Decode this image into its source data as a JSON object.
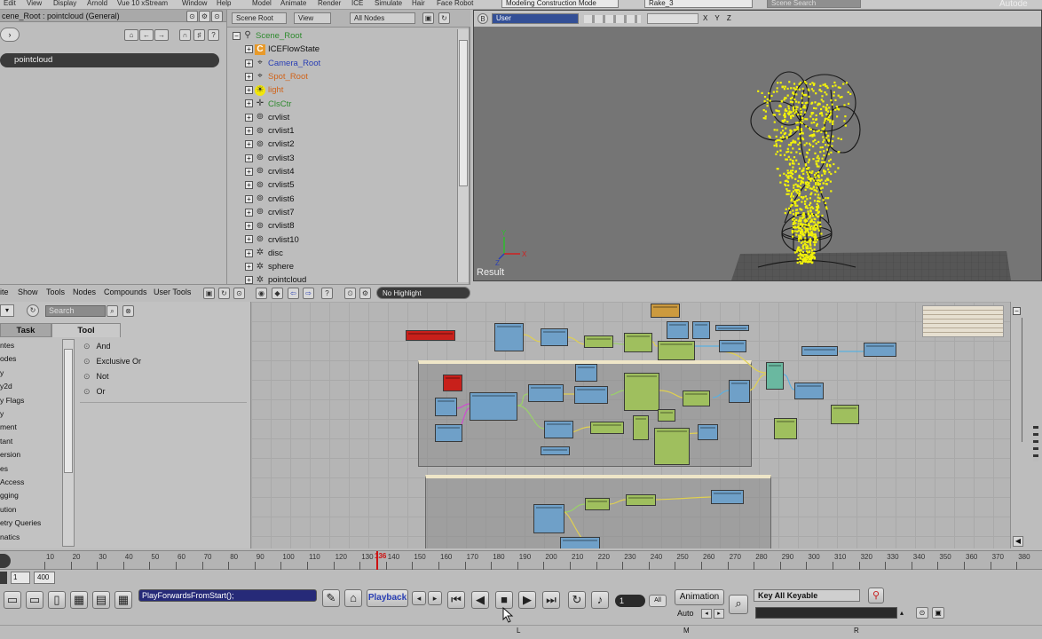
{
  "menubar": {
    "items": [
      "Edit",
      "View",
      "Display",
      "Arnold",
      "Vue 10 xStream",
      "Window",
      "Help",
      "Model",
      "Animate",
      "Render",
      "ICE",
      "Simulate",
      "Hair",
      "Face Robot"
    ],
    "mode": "Modeling Construction Mode",
    "scene_field": "Rake_3",
    "scene_search": "Scene Search",
    "brand": "Autode"
  },
  "explorer": {
    "title": "cene_Root : pointcloud (General)",
    "selected": "pointcloud"
  },
  "scene_tree": {
    "head_root": "Scene Root",
    "head_view": "View",
    "head_filter": "All Nodes",
    "items": [
      {
        "label": "Scene_Root",
        "color": "#2f8a2f",
        "icon": "root-icon",
        "indent": 0
      },
      {
        "label": "ICEFlowState",
        "color": "#111111",
        "icon": "ice-icon",
        "indent": 1
      },
      {
        "label": "Camera_Root",
        "color": "#2a3fb4",
        "icon": "camera-icon",
        "indent": 1
      },
      {
        "label": "Spot_Root",
        "color": "#d0641b",
        "icon": "spotlight-icon",
        "indent": 1
      },
      {
        "label": "light",
        "color": "#d0641b",
        "icon": "light-icon",
        "indent": 1
      },
      {
        "label": "ClsCtr",
        "color": "#2f8a2f",
        "icon": "null-icon",
        "indent": 1
      },
      {
        "label": "crvlist",
        "color": "#111111",
        "icon": "curve-icon",
        "indent": 1
      },
      {
        "label": "crvlist1",
        "color": "#111111",
        "icon": "curve-icon",
        "indent": 1
      },
      {
        "label": "crvlist2",
        "color": "#111111",
        "icon": "curve-icon",
        "indent": 1
      },
      {
        "label": "crvlist3",
        "color": "#111111",
        "icon": "curve-icon",
        "indent": 1
      },
      {
        "label": "crvlist4",
        "color": "#111111",
        "icon": "curve-icon",
        "indent": 1
      },
      {
        "label": "crvlist5",
        "color": "#111111",
        "icon": "curve-icon",
        "indent": 1
      },
      {
        "label": "crvlist6",
        "color": "#111111",
        "icon": "curve-icon",
        "indent": 1
      },
      {
        "label": "crvlist7",
        "color": "#111111",
        "icon": "curve-icon",
        "indent": 1
      },
      {
        "label": "crvlist8",
        "color": "#111111",
        "icon": "curve-icon",
        "indent": 1
      },
      {
        "label": "crvlist10",
        "color": "#111111",
        "icon": "curve-icon",
        "indent": 1
      },
      {
        "label": "disc",
        "color": "#111111",
        "icon": "mesh-icon",
        "indent": 1
      },
      {
        "label": "sphere",
        "color": "#111111",
        "icon": "mesh-icon",
        "indent": 1
      },
      {
        "label": "pointcloud",
        "color": "#111111",
        "icon": "pointcloud-icon",
        "indent": 1
      }
    ]
  },
  "viewport": {
    "camera": "User",
    "axes": "X Y Z",
    "label": "Result"
  },
  "ice_toolbar": {
    "menus": [
      "ite",
      "Show",
      "Tools",
      "Nodes",
      "Compounds",
      "User Tools"
    ],
    "highlight": "No Highlight"
  },
  "ice_left": {
    "search_placeholder": "Search",
    "tab_task": "Task",
    "tab_tool": "Tool",
    "categories": [
      "ntes",
      "odes",
      "y",
      "y2d",
      "y Flags",
      "y",
      "ment",
      "tant",
      "ersion",
      "es",
      "Access",
      "gging",
      "ution",
      "etry Queries",
      "natics"
    ],
    "tools": [
      "And",
      "Exclusive Or",
      "Not",
      "Or"
    ]
  },
  "timeline": {
    "current_frame": "136",
    "ticks": [
      "10",
      "20",
      "30",
      "40",
      "50",
      "60",
      "70",
      "80",
      "90",
      "100",
      "110",
      "120",
      "130",
      "140",
      "150",
      "160",
      "170",
      "180",
      "190",
      "200",
      "210",
      "220",
      "230",
      "240",
      "250",
      "260",
      "270",
      "280",
      "290",
      "300",
      "310",
      "320",
      "330",
      "340",
      "350",
      "360",
      "370",
      "380"
    ]
  },
  "playback": {
    "start_frame": "1",
    "end_frame": "400",
    "script_field": "PlayForwardsFromStart();",
    "playback_label": "Playback",
    "frame_field": "1",
    "all_label": "All",
    "animation_label": "Animation",
    "auto_label": "Auto",
    "key_label": "Key All Keyable",
    "lmr": [
      "L",
      "M",
      "R"
    ]
  },
  "colors": {
    "point_yellow": "#f2f20a",
    "current_frame": "#cc1111"
  }
}
